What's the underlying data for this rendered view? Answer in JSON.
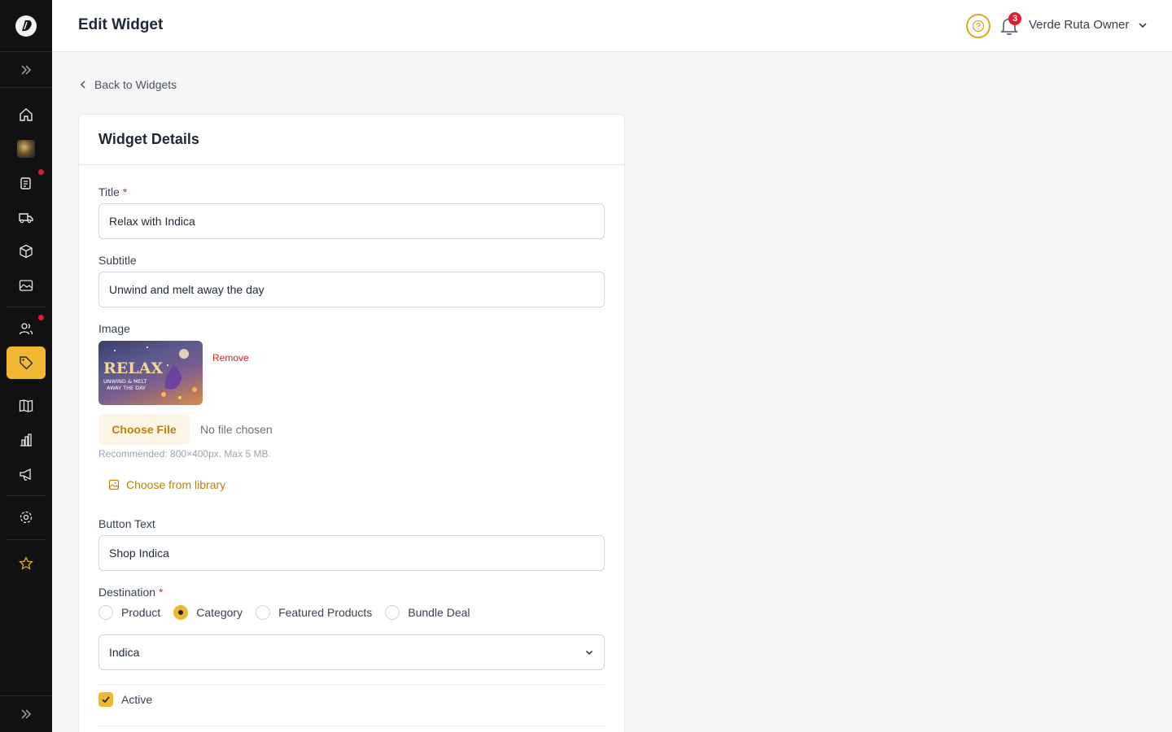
{
  "header": {
    "title": "Edit Widget",
    "notification_count": "3",
    "user_name": "Verde Ruta Owner"
  },
  "back_link": "Back to Widgets",
  "card": {
    "title": "Widget Details"
  },
  "form": {
    "title_label": "Title",
    "title_value": "Relax with Indica",
    "subtitle_label": "Subtitle",
    "subtitle_value": "Unwind and melt away the day",
    "image_label": "Image",
    "image_text_line1": "RELAX",
    "image_text_line2": "UNWIND & MELT",
    "image_text_line3": "AWAY THE DAY",
    "remove_label": "Remove",
    "choose_file_label": "Choose File",
    "no_file_text": "No file chosen",
    "hint_text": "Recommended: 800×400px. Max 5 MB.",
    "library_label": "Choose from library",
    "button_text_label": "Button Text",
    "button_text_value": "Shop Indica",
    "destination_label": "Destination",
    "destination_options": [
      "Product",
      "Category",
      "Featured Products",
      "Bundle Deal"
    ],
    "destination_selected": "Category",
    "category_value": "Indica",
    "active_label": "Active",
    "active_checked": true
  },
  "colors": {
    "accent": "#f1b733",
    "sidebar_bg": "#111111",
    "danger": "#e11d2e"
  }
}
